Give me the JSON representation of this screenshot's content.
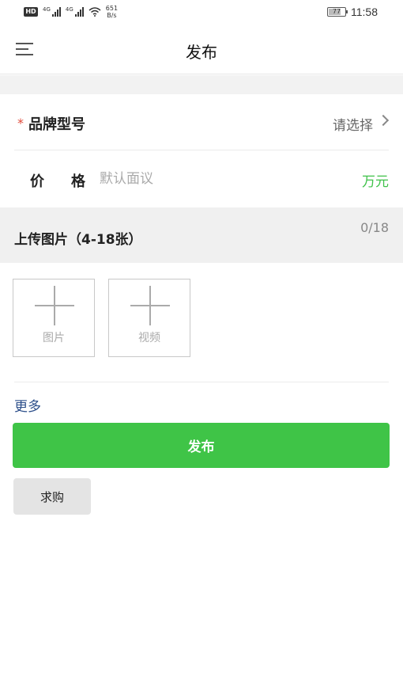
{
  "status_bar": {
    "hd_label": "HD",
    "net_label_1": "4G",
    "net_label_2": "4G",
    "speed_value": "651",
    "speed_unit": "B/s",
    "battery": "77",
    "battery_level": 0.77,
    "time": "11:58"
  },
  "header": {
    "title": "发布",
    "menu_icon": "menu-icon"
  },
  "form": {
    "brand": {
      "required_mark": "*",
      "label": "品牌型号",
      "value": "请选择"
    },
    "price": {
      "label_part1": "价",
      "label_part2": "格",
      "placeholder": "默认面议",
      "unit": "万元"
    }
  },
  "upload": {
    "title": "上传图片（4-18张）",
    "count": "0/18",
    "photo_label": "图片",
    "video_label": "视频"
  },
  "more_label": "更多",
  "publish_label": "发布",
  "buy_label": "求购",
  "colors": {
    "accent_green": "#3fc447",
    "required_red": "#e04a3a",
    "link_blue": "#2d4f8a"
  }
}
